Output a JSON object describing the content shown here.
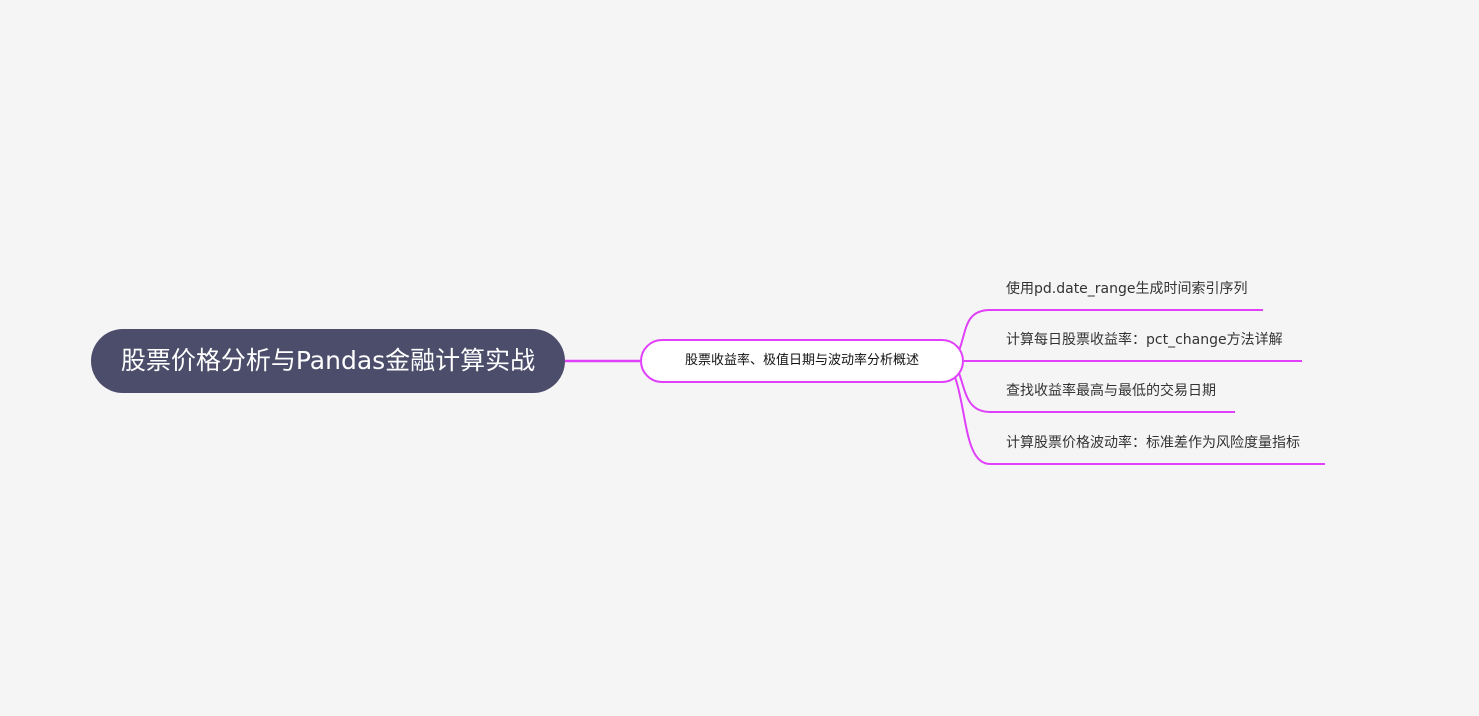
{
  "mindmap": {
    "root": {
      "label": "股票价格分析与Pandas金融计算实战"
    },
    "branch": {
      "label": "股票收益率、极值日期与波动率分析概述",
      "children": [
        {
          "label": "使用pd.date_range生成时间索引序列"
        },
        {
          "label": "计算每日股票收益率：pct_change方法详解"
        },
        {
          "label": "查找收益率最高与最低的交易日期"
        },
        {
          "label": "计算股票价格波动率：标准差作为风险度量指标"
        }
      ]
    },
    "colors": {
      "background": "#f5f5f5",
      "root_fill": "#4b4d6b",
      "link": "#e040fb"
    }
  }
}
